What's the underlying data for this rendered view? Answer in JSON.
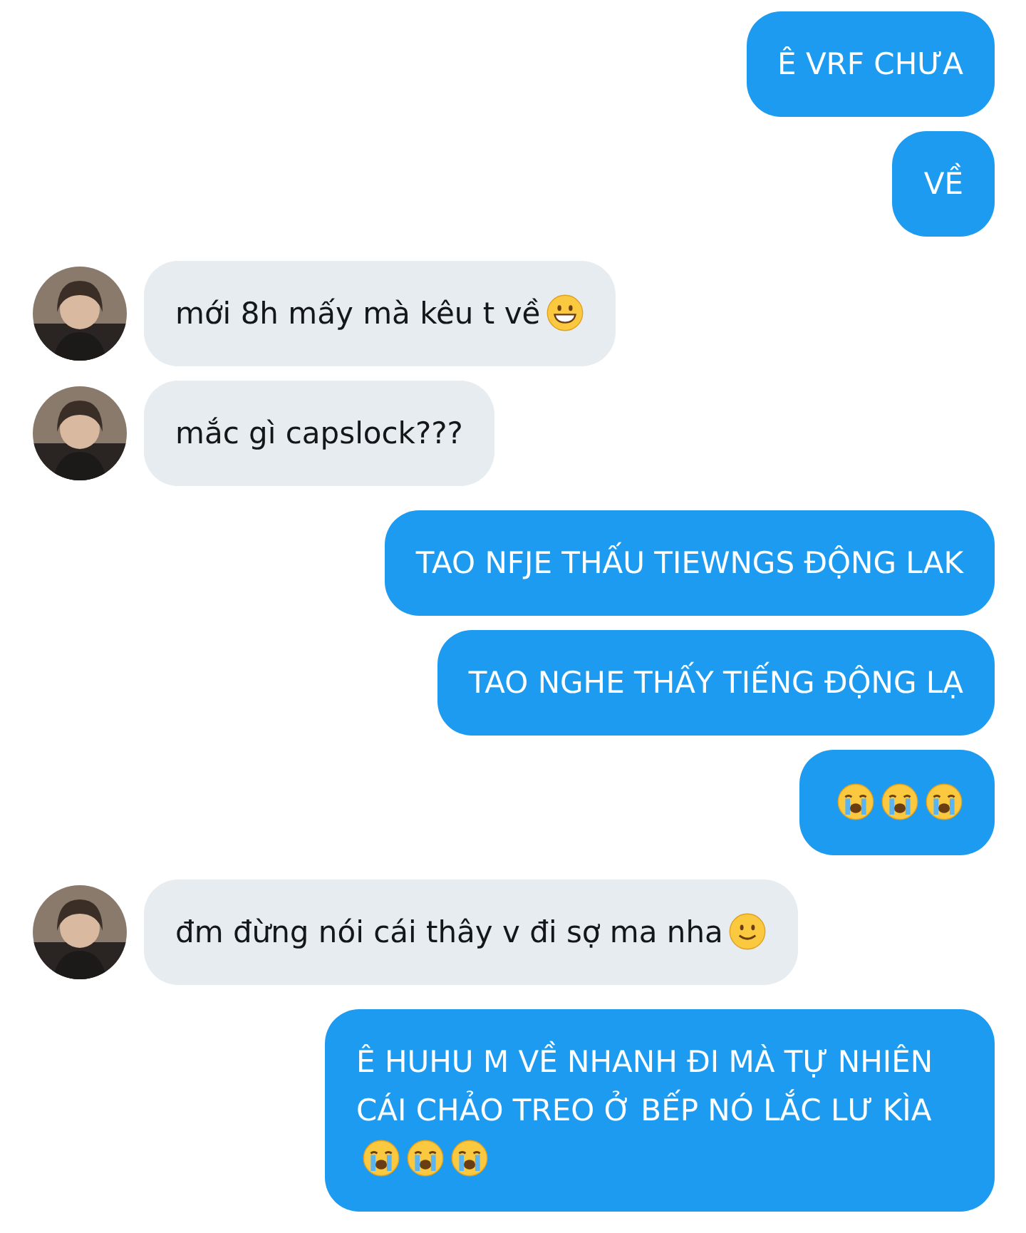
{
  "messages": [
    {
      "kind": "sent",
      "text": "Ê VRF CHƯA"
    },
    {
      "kind": "sent",
      "text": "VỀ"
    },
    {
      "kind": "received",
      "text": "mới 8h mấy mà kêu t về",
      "emojis": [
        {
          "kind": "grin"
        }
      ]
    },
    {
      "kind": "received",
      "text": "mắc gì capslock???"
    },
    {
      "kind": "sent",
      "text": "TAO NFJE THẤU TIEWNGS ĐỘNG LAK"
    },
    {
      "kind": "sent",
      "text": "TAO NGHE THẤY TIẾNG ĐỘNG LẠ"
    },
    {
      "kind": "sent",
      "emojis": [
        {
          "kind": "sob"
        },
        {
          "kind": "sob"
        },
        {
          "kind": "sob"
        }
      ]
    },
    {
      "kind": "received",
      "text": "đm đừng nói cái thây v đi sợ ma nha",
      "emojis": [
        {
          "kind": "smile"
        }
      ]
    },
    {
      "kind": "sent",
      "text": "Ê HUHU M VỀ NHANH ĐI MÀ TỰ NHIÊN CÁI CHẢO TREO Ở BẾP NÓ LẮC LƯ KÌA",
      "emojis": [
        {
          "kind": "sob"
        },
        {
          "kind": "sob"
        },
        {
          "kind": "sob"
        }
      ]
    }
  ]
}
